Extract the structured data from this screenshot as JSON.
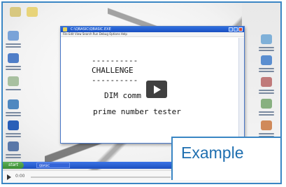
{
  "video_frame": {
    "window": {
      "title": "C:\\QBASIC\\QBASIC.EXE",
      "menu": "File  Edit  View  Search  Run  Debug  Options  Help",
      "lines": [
        "----------",
        "CHALLENGE",
        "----------",
        "DIM comm",
        "prime number tester"
      ]
    },
    "taskbar": {
      "start_label": "start",
      "task_label": "QBASIC"
    },
    "banner": {
      "text": "Example"
    },
    "player": {
      "time": "0:00"
    },
    "colors": {
      "accent": "#3a86c4",
      "banner_text": "#1f6fb0",
      "titlebar": "#1a4fc0",
      "start_button": "#3a8c33"
    }
  }
}
